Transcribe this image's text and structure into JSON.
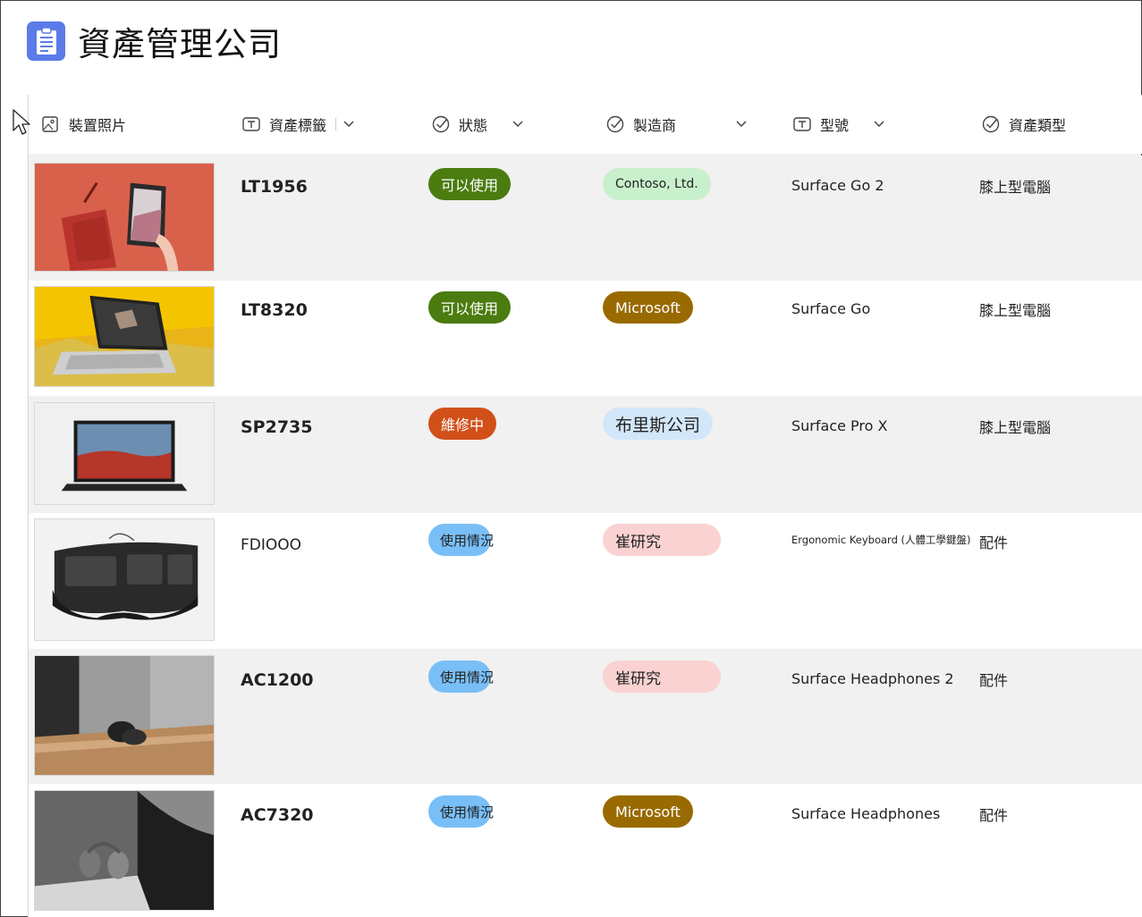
{
  "app": {
    "title": "資產管理公司",
    "icon": "clipboard-icon"
  },
  "columns": [
    {
      "key": "photo",
      "label": "裝置照片",
      "icon": "image-icon"
    },
    {
      "key": "tag",
      "label": "資產標籤",
      "icon": "text-icon"
    },
    {
      "key": "status",
      "label": "狀態",
      "icon": "choice-icon"
    },
    {
      "key": "maker",
      "label": "製造商",
      "icon": "choice-icon"
    },
    {
      "key": "model",
      "label": "型號",
      "icon": "text-icon"
    },
    {
      "key": "type",
      "label": "資產類型",
      "icon": "choice-icon"
    }
  ],
  "rows": [
    {
      "tag": "LT1956",
      "status": "可以使用",
      "maker": "Contoso, Ltd.",
      "model": "Surface Go 2",
      "type": "膝上型電腦",
      "photo": "tablet-with-red-keyboard"
    },
    {
      "tag": "LT8320",
      "status": "可以使用",
      "maker": "Microsoft",
      "model": "Surface Go",
      "type": "膝上型電腦",
      "photo": "laptop-on-yellow"
    },
    {
      "tag": "SP2735",
      "status": "維修中",
      "maker": "布里斯公司",
      "model": "Surface Pro X",
      "type": "膝上型電腦",
      "photo": "surface-pro-x"
    },
    {
      "tag": "FDIOOO",
      "status": "使用情況",
      "maker": "崔研究",
      "model": "Ergonomic Keyboard (人體工學鍵盤)",
      "type": "配件",
      "photo": "ergonomic-keyboard"
    },
    {
      "tag": "AC1200",
      "status": "使用情況",
      "maker": "崔研究",
      "model": "Surface Headphones 2",
      "type": "配件",
      "photo": "headphones-on-shelf"
    },
    {
      "tag": "AC7320",
      "status": "使用情況",
      "maker": "Microsoft",
      "model": "Surface Headphones",
      "type": "配件",
      "photo": "headphones-grey"
    }
  ],
  "colors": {
    "available": "#4a7c0f",
    "repair": "#d1501a",
    "in_use": "#79bff7",
    "contoso": "#c9f0cc",
    "microsoft": "#996a00",
    "bris": "#d2e7f9",
    "cui": "#fad2d2",
    "app_icon": "#5b7ce8"
  }
}
